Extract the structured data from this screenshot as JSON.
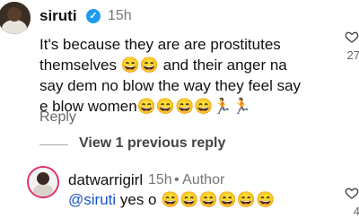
{
  "comment": {
    "username": "siruti",
    "time": "15h",
    "text": "It's because they are are prostitutes themselves 😄😄 and their anger na say dem no blow the way they feel say e blow women😄😄😄😄🏃🏃",
    "reply_label": "Reply",
    "like_count": "27"
  },
  "thread": {
    "view_previous_label": "View 1 previous reply"
  },
  "reply": {
    "username": "datwarrigirl",
    "time": "15h",
    "author_label": "• Author",
    "mention": "@siruti",
    "text": " yes o 😄😄😄😄😄😄",
    "like_count": "4"
  },
  "icons": {
    "verified": "verified-badge-icon",
    "like": "heart-outline-icon"
  },
  "colors": {
    "verified": "#1d9bf0",
    "mention": "#1a56c8",
    "story_ring": "#e1306c"
  }
}
